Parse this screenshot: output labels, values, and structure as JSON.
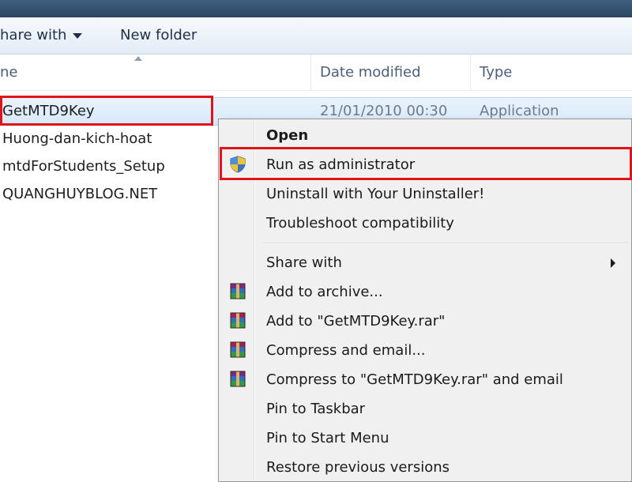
{
  "toolbar": {
    "share_with": "hare with",
    "new_folder": "New folder"
  },
  "columns": {
    "name": "ne",
    "date_modified": "Date modified",
    "type": "Type"
  },
  "files": [
    {
      "name": "GetMTD9Key",
      "date": "21/01/2010 00:30",
      "type": "Application"
    },
    {
      "name": "Huong-dan-kich-hoat",
      "date": "",
      "type": ""
    },
    {
      "name": "mtdForStudents_Setup",
      "date": "",
      "type": ""
    },
    {
      "name": "QUANGHUYBLOG.NET",
      "date": "",
      "type": ""
    }
  ],
  "context_menu": {
    "items": [
      {
        "label": "Open",
        "icon": ""
      },
      {
        "label": "Run as administrator",
        "icon": "uac-shield-icon"
      },
      {
        "label": "Uninstall with Your Uninstaller!",
        "icon": ""
      },
      {
        "label": "Troubleshoot compatibility",
        "icon": ""
      },
      {
        "label": "Share with",
        "icon": "",
        "submenu": true
      },
      {
        "label": "Add to archive...",
        "icon": "winrar-icon"
      },
      {
        "label": "Add to \"GetMTD9Key.rar\"",
        "icon": "winrar-icon"
      },
      {
        "label": "Compress and email...",
        "icon": "winrar-icon"
      },
      {
        "label": "Compress to \"GetMTD9Key.rar\" and email",
        "icon": "winrar-icon"
      },
      {
        "label": "Pin to Taskbar",
        "icon": ""
      },
      {
        "label": "Pin to Start Menu",
        "icon": ""
      },
      {
        "label": "Restore previous versions",
        "icon": ""
      }
    ]
  },
  "colors": {
    "highlight_box": "#e0131a",
    "selection": "#d6e8fb",
    "menu_bg": "#f0f0f0"
  }
}
